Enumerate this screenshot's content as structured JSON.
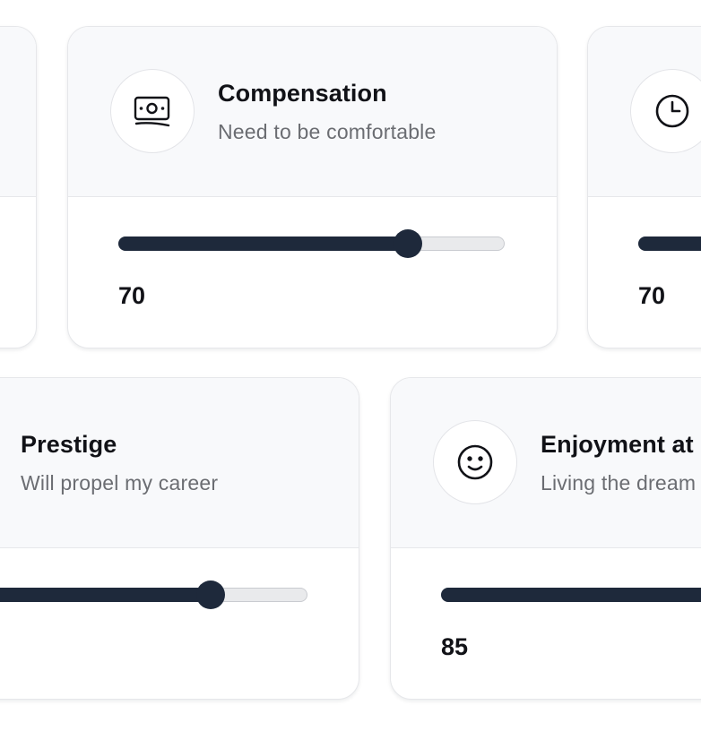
{
  "cards": [
    {
      "title": "",
      "subtitle": "",
      "value": "",
      "icon": ""
    },
    {
      "title": "Compensation",
      "subtitle": "Need to be comfortable",
      "value": "70",
      "icon": "money-icon",
      "slider_percent": 75
    },
    {
      "title": "",
      "subtitle": "",
      "value": "70",
      "icon": "clock-icon",
      "slider_percent": 70
    },
    {
      "title": "Prestige",
      "subtitle": "Will propel my career",
      "value": "",
      "icon": "",
      "slider_percent": 75
    },
    {
      "title": "Enjoyment at",
      "subtitle": "Living the dream",
      "value": "85",
      "icon": "smile-icon",
      "slider_percent": 85
    }
  ],
  "colors": {
    "track_fill": "#1e293b",
    "track_empty": "#e9eaec",
    "card_head_bg": "#f8f9fb"
  }
}
